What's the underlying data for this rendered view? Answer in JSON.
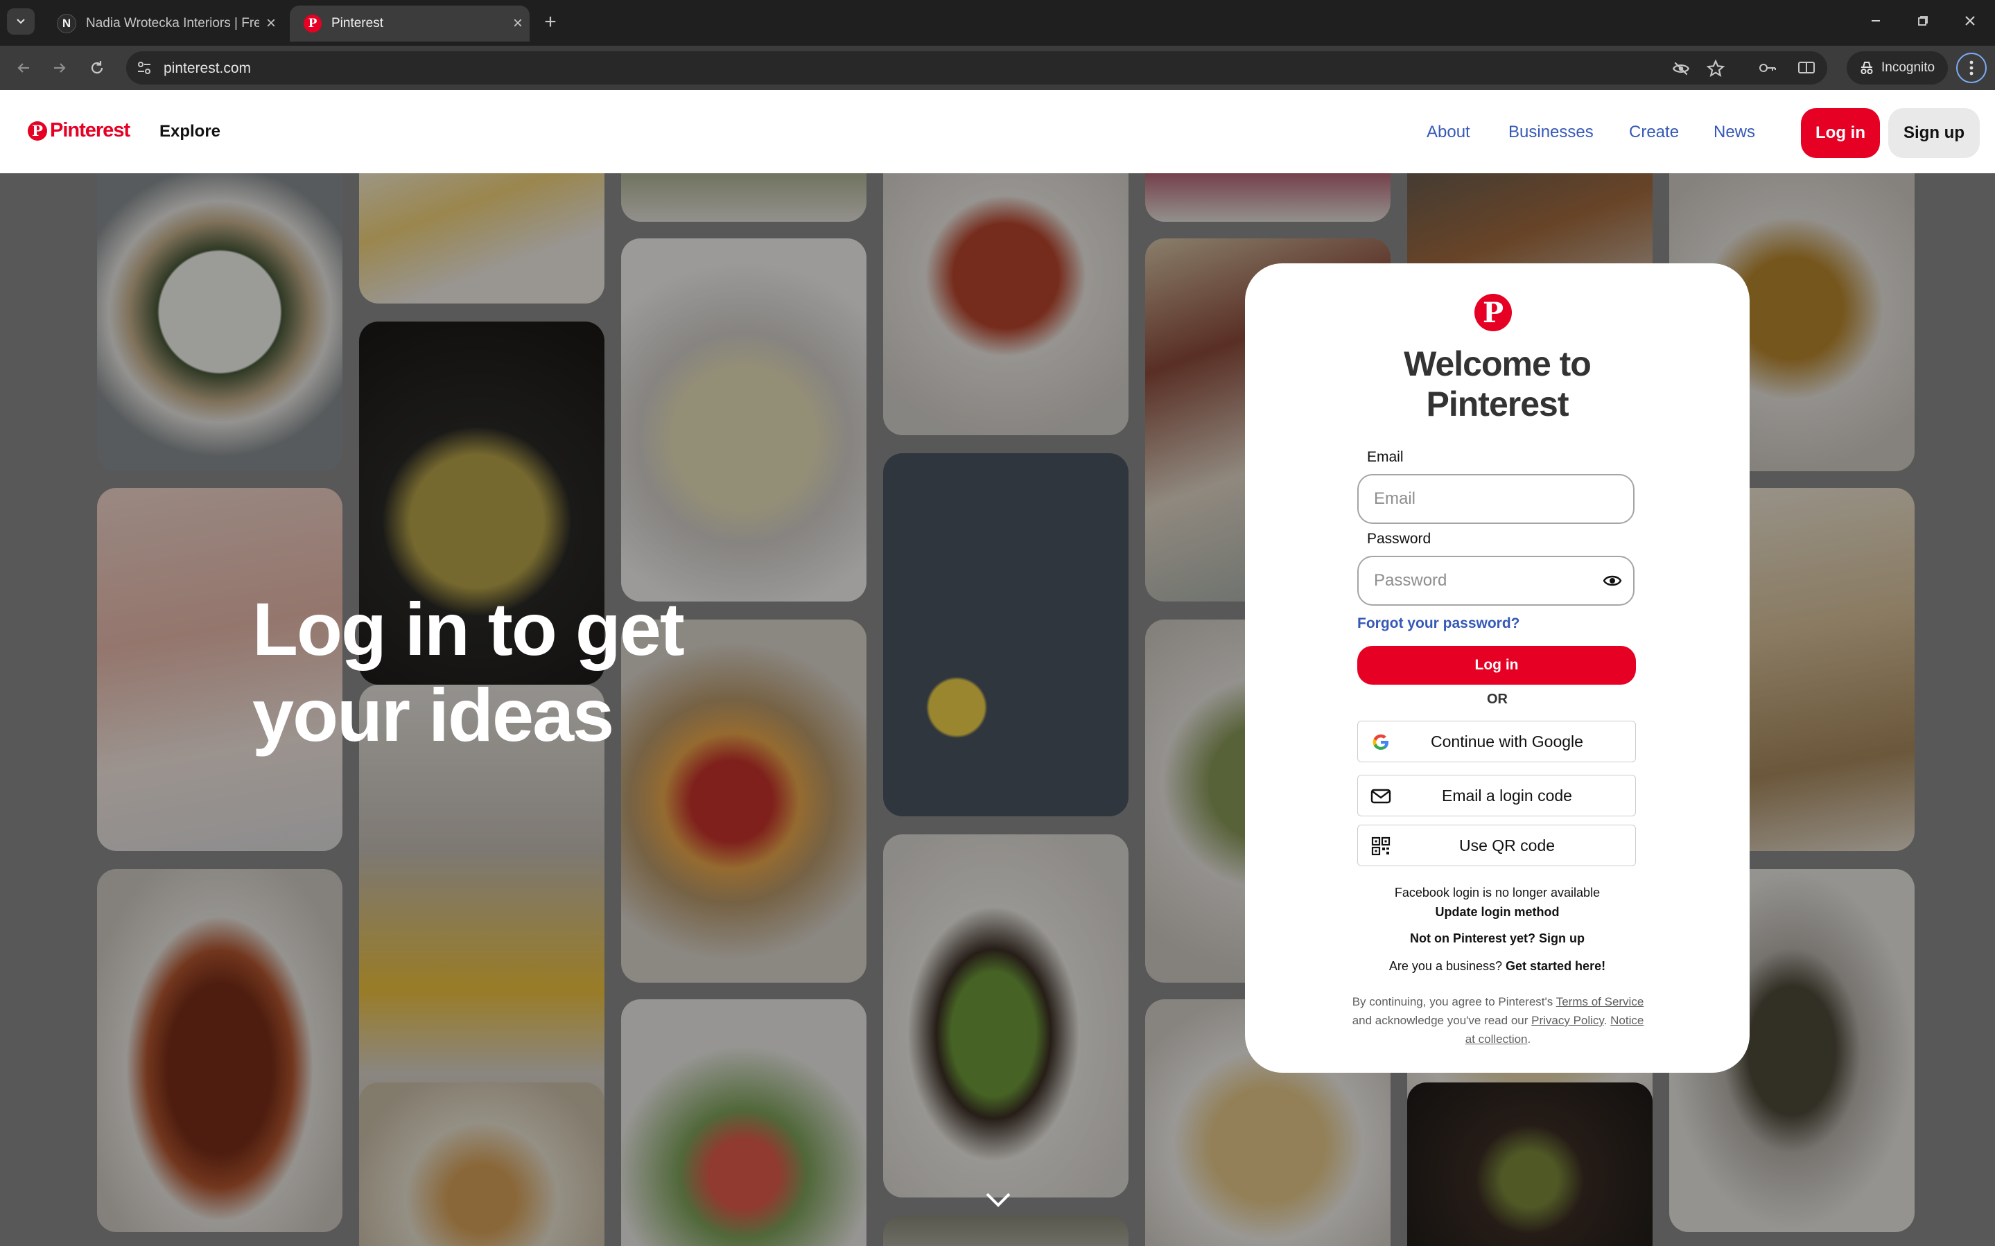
{
  "browser": {
    "tabs": [
      {
        "favicon": "N",
        "title": "Nadia Wrotecka Interiors | Free",
        "active": false
      },
      {
        "favicon": "P",
        "title": "Pinterest",
        "active": true
      }
    ],
    "url": "pinterest.com",
    "incognito_label": "Incognito"
  },
  "header": {
    "logo_text": "Pinterest",
    "explore": "Explore",
    "links": [
      "About",
      "Businesses",
      "Create",
      "News"
    ],
    "login": "Log in",
    "signup": "Sign up"
  },
  "hero": {
    "headline_line1": "Log in to get",
    "headline_line2": "your ideas"
  },
  "modal": {
    "title_line1": "Welcome to",
    "title_line2": "Pinterest",
    "email_label": "Email",
    "email_placeholder": "Email",
    "password_label": "Password",
    "password_placeholder": "Password",
    "forgot": "Forgot your password?",
    "login_button": "Log in",
    "or": "OR",
    "google": "Continue with Google",
    "email_code": "Email a login code",
    "qr": "Use QR code",
    "fb_notice": "Facebook login is no longer available",
    "update_method": "Update login method",
    "not_on": "Not on Pinterest yet? Sign up",
    "business_q": "Are you a business?",
    "business_link": "Get started here!",
    "legal_1": "By continuing, you agree to Pinterest's",
    "legal_terms": "Terms of Service",
    "legal_2": "and acknowledge you've read our",
    "legal_privacy": "Privacy Policy",
    "legal_notice": "Notice at collection"
  },
  "colors": {
    "brand_red": "#e60023",
    "link_blue": "#3659b7",
    "chrome_dark": "#1f1f1f"
  }
}
